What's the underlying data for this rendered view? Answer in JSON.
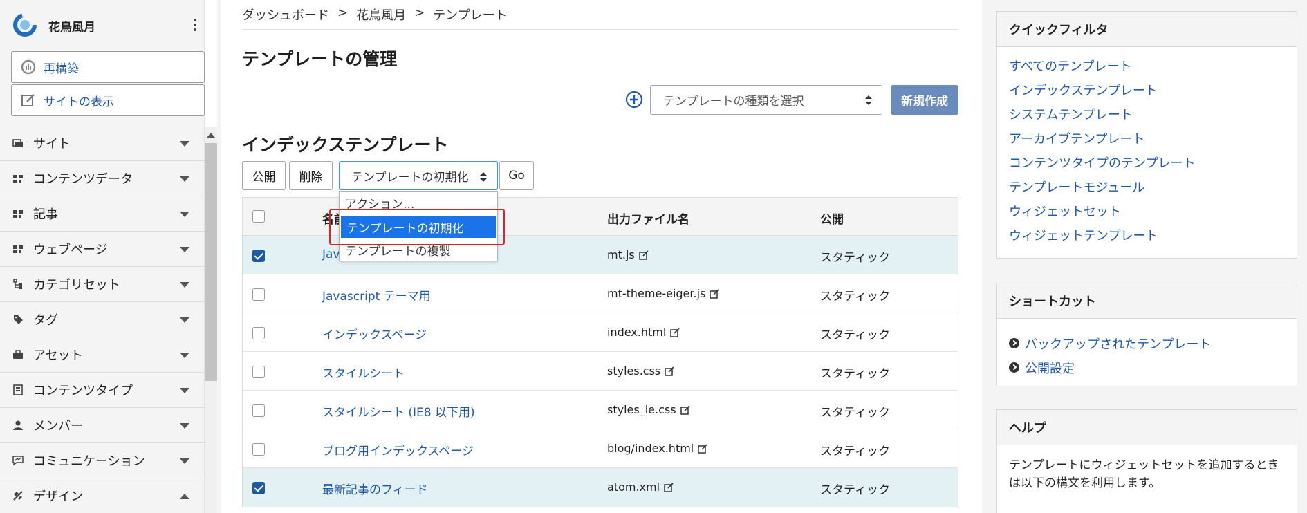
{
  "brand": {
    "name": "花鳥風月"
  },
  "sidebar": {
    "rebuild_label": "再構築",
    "view_site_label": "サイトの表示",
    "items": [
      {
        "label": "サイト",
        "icon": "site-icon"
      },
      {
        "label": "コンテンツデータ",
        "icon": "content-data-icon"
      },
      {
        "label": "記事",
        "icon": "entries-icon"
      },
      {
        "label": "ウェブページ",
        "icon": "webpages-icon"
      },
      {
        "label": "カテゴリセット",
        "icon": "category-set-icon"
      },
      {
        "label": "タグ",
        "icon": "tag-icon"
      },
      {
        "label": "アセット",
        "icon": "assets-icon"
      },
      {
        "label": "コンテンツタイプ",
        "icon": "content-type-icon"
      },
      {
        "label": "メンバー",
        "icon": "member-icon"
      },
      {
        "label": "コミュニケーション",
        "icon": "communication-icon"
      },
      {
        "label": "デザイン",
        "icon": "design-icon"
      }
    ]
  },
  "breadcrumb": [
    "ダッシュボード",
    "花鳥風月",
    "テンプレート"
  ],
  "breadcrumb_sep": ">",
  "page": {
    "title": "テンプレートの管理",
    "type_select_placeholder": "テンプレートの種類を選択",
    "new_button": "新規作成",
    "section_title": "インデックステンプレート"
  },
  "actions": {
    "publish": "公開",
    "delete": "削除",
    "selected_action": "テンプレートの初期化",
    "go": "Go",
    "options": [
      "アクション...",
      "テンプレートの初期化",
      "テンプレートの複製"
    ]
  },
  "table": {
    "headers": {
      "name": "名前",
      "output_file": "出力ファイル名",
      "publish": "公開"
    },
    "rows": [
      {
        "name": "Javascript",
        "file": "mt.js",
        "publish": "スタティック",
        "checked": true
      },
      {
        "name": "Javascript テーマ用",
        "file": "mt-theme-eiger.js",
        "publish": "スタティック",
        "checked": false
      },
      {
        "name": "インデックスページ",
        "file": "index.html",
        "publish": "スタティック",
        "checked": false
      },
      {
        "name": "スタイルシート",
        "file": "styles.css",
        "publish": "スタティック",
        "checked": false
      },
      {
        "name": "スタイルシート (IE8 以下用)",
        "file": "styles_ie.css",
        "publish": "スタティック",
        "checked": false
      },
      {
        "name": "ブログ用インデックスページ",
        "file": "blog/index.html",
        "publish": "スタティック",
        "checked": false
      },
      {
        "name": "最新記事のフィード",
        "file": "atom.xml",
        "publish": "スタティック",
        "checked": true
      }
    ]
  },
  "quick_filter": {
    "title": "クイックフィルタ",
    "links": [
      "すべてのテンプレート",
      "インデックステンプレート",
      "システムテンプレート",
      "アーカイブテンプレート",
      "コンテンツタイプのテンプレート",
      "テンプレートモジュール",
      "ウィジェットセット",
      "ウィジェットテンプレート"
    ]
  },
  "shortcuts": {
    "title": "ショートカット",
    "links": [
      "バックアップされたテンプレート",
      "公開設定"
    ]
  },
  "help": {
    "title": "ヘルプ",
    "text": "テンプレートにウィジェットセットを追加するときは以下の構文を利用します。"
  },
  "colors": {
    "link": "#1e5aa8",
    "primary_button": "#6a8cbd",
    "selected_row": "#e4f1f4",
    "highlight_frame": "#e0202a"
  }
}
